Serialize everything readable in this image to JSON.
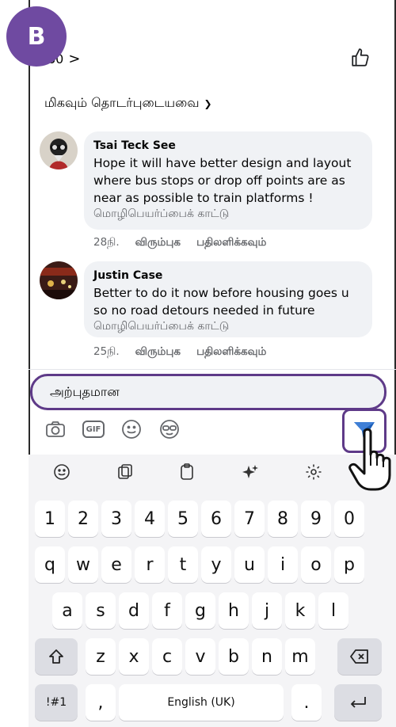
{
  "step": {
    "label": "B"
  },
  "header": {
    "reaction_count": "60",
    "chevron": ">"
  },
  "sort": {
    "label": "மிகவும் தொடர்புடையவை"
  },
  "comments": [
    {
      "author": "Tsai Teck See",
      "text": "Hope it will have better design and layout where bus stops or drop off points are as near as possible to train platforms !",
      "translate": "மொழிபெயர்ப்பைக் காட்டு",
      "time": "28நி.",
      "like": "விரும்புக",
      "reply": "பதிலளிக்கவும்"
    },
    {
      "author": "Justin Case",
      "text": "Better to do it now before housing goes u so no road detours needed in future",
      "translate": "மொழிபெயர்ப்பைக் காட்டு",
      "time": "25நி.",
      "like": "விரும்புக",
      "reply": "பதிலளிக்கவும்"
    }
  ],
  "composer": {
    "value": "அற்புதமான"
  },
  "colors": {
    "accent": "#5e3a88",
    "brand": "#1877f2",
    "send": "#1b5eb8"
  },
  "icons": [
    "camera-icon",
    "gif-icon",
    "emoji-icon",
    "avatar-sticker-icon",
    "send-icon"
  ],
  "keyboard": {
    "numbers": [
      "1",
      "2",
      "3",
      "4",
      "5",
      "6",
      "7",
      "8",
      "9",
      "0"
    ],
    "row1": [
      "q",
      "w",
      "e",
      "r",
      "t",
      "y",
      "u",
      "i",
      "o",
      "p"
    ],
    "row2": [
      "a",
      "s",
      "d",
      "f",
      "g",
      "h",
      "j",
      "k",
      "l"
    ],
    "row3": [
      "z",
      "x",
      "c",
      "v",
      "b",
      "n",
      "m"
    ],
    "sym_label": "!#1",
    "comma": ",",
    "space_label": "English (UK)",
    "period": "."
  }
}
